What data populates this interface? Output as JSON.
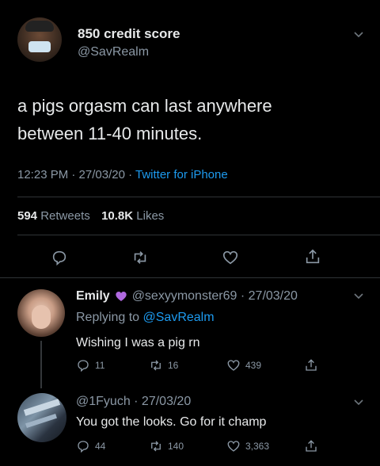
{
  "main_tweet": {
    "display_name": "850 credit score",
    "handle": "@SavRealm",
    "text_line1": "a pigs orgasm can last anywhere",
    "text_line2": "between 11-40 minutes.",
    "meta_time": "12:23 PM · 27/03/20 · ",
    "meta_source": "Twitter for iPhone",
    "retweets_count": "594",
    "retweets_label": "Retweets",
    "likes_count": "10.8K",
    "likes_label": "Likes"
  },
  "reply1": {
    "display_name": "Emily",
    "handle_date": "@sexyymonster69 · 27/03/20",
    "replying_prefix": "Replying to ",
    "replying_handle": "@SavRealm",
    "text": "Wishing I was a pig rn",
    "replies": "11",
    "retweets": "16",
    "likes": "439"
  },
  "reply2": {
    "handle_date": "@1Fyuch · 27/03/20",
    "text": "You got the looks. Go for it champ",
    "replies": "44",
    "retweets": "140",
    "likes": "3,363"
  },
  "colors": {
    "background": "#000000",
    "heart_emoji": "#b069e0",
    "link_blue": "#1d9bf0"
  },
  "icons": [
    "chevron-down-icon",
    "reply-icon",
    "retweet-icon",
    "like-icon",
    "share-icon",
    "purple-heart-icon"
  ]
}
